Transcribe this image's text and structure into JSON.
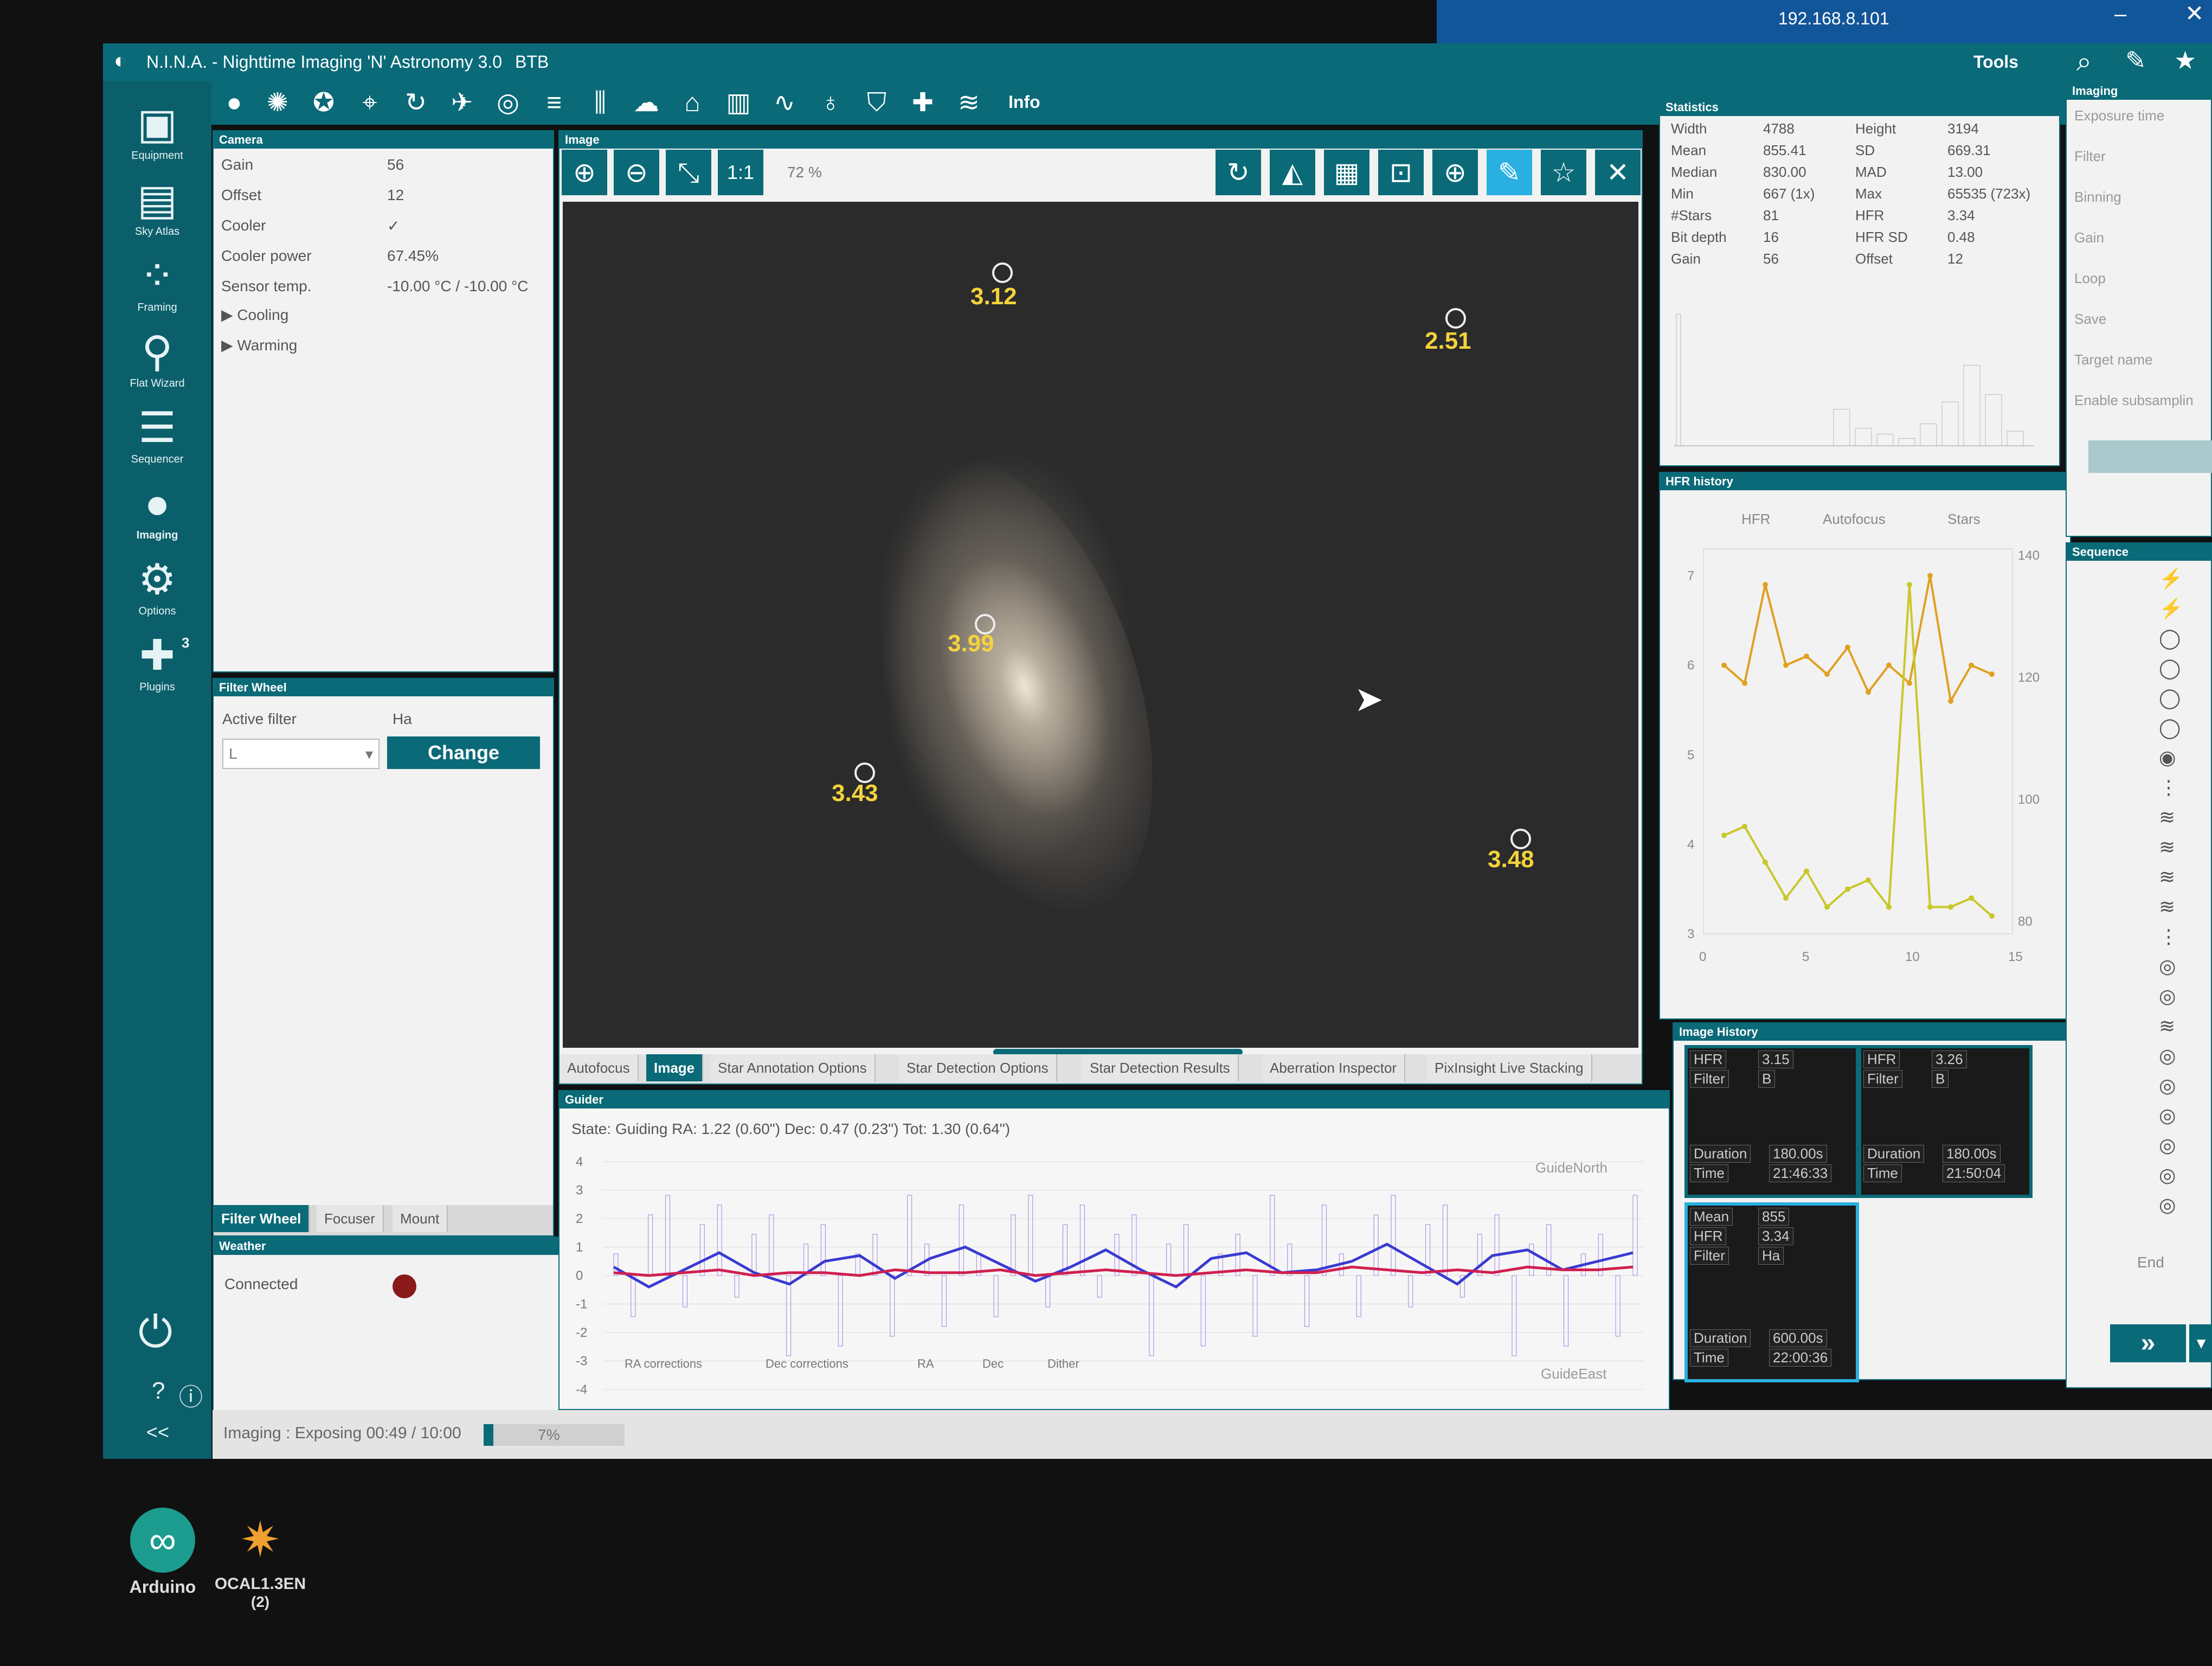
{
  "rdp": {
    "ip": "192.168.8.101"
  },
  "window": {
    "title": "N.I.N.A. - Nighttime Imaging 'N' Astronomy 3.0",
    "profile": "BTB",
    "tools_label": "Tools"
  },
  "toolbar": {
    "info_label": "Info"
  },
  "nav": {
    "items": [
      {
        "label": "Equipment"
      },
      {
        "label": "Sky Atlas"
      },
      {
        "label": "Framing"
      },
      {
        "label": "Flat Wizard"
      },
      {
        "label": "Sequencer"
      },
      {
        "label": "Imaging"
      },
      {
        "label": "Options"
      },
      {
        "label": "Plugins",
        "badge": "3"
      }
    ],
    "collapse": "<<"
  },
  "camera": {
    "title": "Camera",
    "rows": [
      {
        "label": "Gain",
        "value": "56"
      },
      {
        "label": "Offset",
        "value": "12"
      },
      {
        "label": "Cooler",
        "value": "✓"
      },
      {
        "label": "Cooler power",
        "value": "67.45%"
      },
      {
        "label": "Sensor temp.",
        "value": "-10.00 °C / -10.00 °C"
      }
    ],
    "cooling": "Cooling",
    "warming": "Warming"
  },
  "filterwheel": {
    "title": "Filter Wheel",
    "active_label": "Active filter",
    "active_value": "Ha",
    "select_value": "L",
    "change": "Change",
    "tabs": [
      "Filter Wheel",
      "Focuser",
      "Mount"
    ]
  },
  "weather": {
    "title": "Weather",
    "connected": "Connected",
    "status_color": "#8a1a1a"
  },
  "image": {
    "title": "Image",
    "zoom": "72 %",
    "one_to_one": "1:1",
    "stars": [
      {
        "hfr": "3.12"
      },
      {
        "hfr": "2.51"
      },
      {
        "hfr": "3.99"
      },
      {
        "hfr": "3.43"
      },
      {
        "hfr": "3.48"
      }
    ],
    "tabs": [
      "Autofocus",
      "Image",
      "Star Annotation Options",
      "Star Detection Options",
      "Star Detection Results",
      "Aberration Inspector",
      "PixInsight Live Stacking"
    ]
  },
  "statistics": {
    "title": "Statistics",
    "left": [
      {
        "label": "Width",
        "value": "4788"
      },
      {
        "label": "Mean",
        "value": "855.41"
      },
      {
        "label": "Median",
        "value": "830.00"
      },
      {
        "label": "Min",
        "value": "667 (1x)"
      },
      {
        "label": "#Stars",
        "value": "81"
      },
      {
        "label": "Bit depth",
        "value": "16"
      },
      {
        "label": "Gain",
        "value": "56"
      }
    ],
    "right": [
      {
        "label": "Height",
        "value": "3194"
      },
      {
        "label": "SD",
        "value": "669.31"
      },
      {
        "label": "MAD",
        "value": "13.00"
      },
      {
        "label": "Max",
        "value": "65535 (723x)"
      },
      {
        "label": "HFR",
        "value": "3.34"
      },
      {
        "label": "HFR SD",
        "value": "0.48"
      },
      {
        "label": "Offset",
        "value": "12"
      }
    ]
  },
  "hfr_history": {
    "title": "HFR history",
    "legend": [
      "HFR",
      "Autofocus",
      "Stars"
    ],
    "colors": {
      "hfr": "#e0a020",
      "stars": "#c8c82a"
    }
  },
  "imaging_panel": {
    "title": "Imaging",
    "items": [
      "Exposure time",
      "Filter",
      "Binning",
      "Gain",
      "Loop",
      "Save",
      "Target name",
      "Enable subsamplin"
    ]
  },
  "sequence": {
    "title": "Sequence",
    "end_label": "End"
  },
  "image_history": {
    "title": "Image History",
    "thumbs": [
      {
        "hfr": "3.15",
        "filter": "B",
        "duration": "180.00s",
        "time": "21:46:33"
      },
      {
        "hfr": "3.26",
        "filter": "B",
        "duration": "180.00s",
        "time": "21:50:04"
      },
      {
        "mean": "855",
        "hfr": "3.34",
        "filter": "Ha",
        "duration": "600.00s",
        "time": "22:00:36"
      }
    ],
    "labels": {
      "hfr": "HFR",
      "filter": "Filter",
      "duration": "Duration",
      "time": "Time",
      "mean": "Mean"
    }
  },
  "guider": {
    "title": "Guider",
    "state": "State: Guiding  RA: 1.22 (0.60\")  Dec: 0.47 (0.23\")  Tot: 1.30 (0.64\")",
    "north": "GuideNorth",
    "east": "GuideEast",
    "legend": [
      "RA corrections",
      "Dec corrections",
      "RA",
      "Dec",
      "Dither"
    ],
    "colors": {
      "ra": "#3a3ad0",
      "dec": "#d02050",
      "bars": "#a080e0"
    }
  },
  "statusbar": {
    "text": "Imaging :  Exposing 00:49 / 10:00",
    "percent": "7%",
    "progress": 0.07
  },
  "desktop": {
    "icons": [
      {
        "label": "Arduino"
      },
      {
        "label": "OCAL1.3EN"
      },
      {
        "label": "(2)"
      }
    ]
  },
  "chart_data": [
    {
      "type": "line",
      "title": "HFR history",
      "x": [
        1,
        2,
        3,
        4,
        5,
        6,
        7,
        8,
        9,
        10,
        11,
        12,
        13,
        14
      ],
      "series": [
        {
          "name": "HFR",
          "values": [
            6,
            5.8,
            6.9,
            6,
            6.1,
            5.9,
            6.2,
            5.7,
            6,
            5.8,
            7,
            5.6,
            6,
            5.9
          ]
        },
        {
          "name": "Stars",
          "values": [
            4.1,
            4.2,
            3.8,
            3.4,
            3.7,
            3.3,
            3.5,
            3.6,
            3.3,
            6.9,
            3.3,
            3.3,
            3.4,
            3.2
          ]
        }
      ],
      "x_ticks": [
        "0",
        "5",
        "10",
        "15"
      ],
      "y_ticks_left": [
        "3",
        "4",
        "5",
        "6",
        "7"
      ],
      "y_ticks_right": [
        "80",
        "100",
        "120",
        "140"
      ],
      "xlim": [
        0,
        15
      ],
      "ylim": [
        3,
        7.3
      ]
    },
    {
      "type": "line",
      "title": "Guider",
      "y_ticks": [
        "4",
        "3",
        "2",
        "1",
        "0",
        "-1",
        "-2",
        "-3",
        "-4"
      ],
      "ylim": [
        -4,
        4
      ],
      "series": [
        {
          "name": "RA",
          "values": [
            0.3,
            -0.4,
            0.2,
            0.8,
            0.1,
            -0.3,
            0.5,
            0.7,
            -0.1,
            0.6,
            1,
            0.4,
            -0.2,
            0.3,
            0.9,
            0.2,
            -0.4,
            0.6,
            0.8,
            0.1,
            0.2,
            0.5,
            1.1,
            0.4,
            -0.3,
            0.7,
            0.9,
            0.2,
            0.5,
            0.8
          ]
        },
        {
          "name": "Dec",
          "values": [
            0.1,
            0,
            0.1,
            0.2,
            0,
            0.1,
            0.1,
            0,
            0.2,
            0.1,
            0.1,
            0.2,
            0,
            0.1,
            0.2,
            0.1,
            0,
            0.1,
            0.2,
            0.1,
            0.1,
            0.3,
            0.2,
            0.1,
            0.2,
            0.1,
            0.3,
            0.2,
            0.2,
            0.3
          ]
        }
      ]
    }
  ]
}
